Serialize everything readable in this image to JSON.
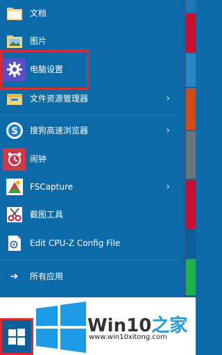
{
  "start_menu": {
    "items": [
      {
        "label": "文档",
        "icon": "folder-icon",
        "arrow": false
      },
      {
        "label": "图片",
        "icon": "folder-icon",
        "arrow": false
      },
      {
        "label": "电脑设置",
        "icon": "gear-icon",
        "arrow": false
      },
      {
        "label": "文件资源管理器",
        "icon": "file-explorer-icon",
        "arrow": true
      },
      {
        "label": "搜狗高速浏览器",
        "icon": "sogou-browser-icon",
        "arrow": true
      },
      {
        "label": "闹钟",
        "icon": "alarm-clock-icon",
        "arrow": false
      },
      {
        "label": "FSCapture",
        "icon": "fscapture-icon",
        "arrow": true
      },
      {
        "label": "截图工具",
        "icon": "scissors-icon",
        "arrow": false
      },
      {
        "label": "Edit CPU-Z Config File",
        "icon": "config-file-icon",
        "arrow": false
      }
    ],
    "all_apps_label": "所有应用",
    "arrow_glyph": "›"
  },
  "watermark": {
    "brand_prefix": "Win10",
    "brand_suffix": "之家",
    "url": "www.win10xitong.com"
  },
  "colors": {
    "menu_bg": "#0d6aa9",
    "highlight_border": "#d42f37",
    "tile_colors": [
      "#1f76b8",
      "#c8102e",
      "#2b86c7",
      "#d04a1a",
      "#28a745",
      "#0b5f99",
      "#c8102e",
      "#20b24a"
    ]
  }
}
